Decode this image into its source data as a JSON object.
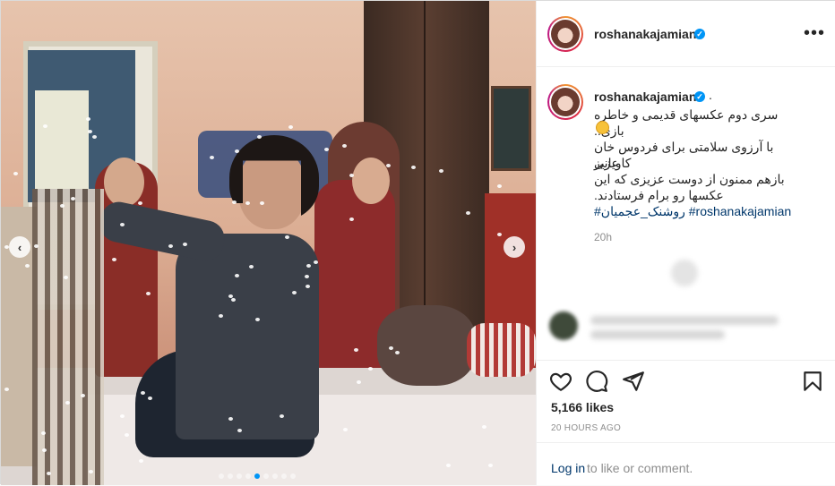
{
  "post": {
    "username": "roshanakajamian",
    "verified_mark": "✓",
    "more_label": "•••",
    "caption": {
      "username": "roshanakajamian",
      "trailing_dot": ".",
      "line1": "سری دوم عکسهای قدیمی و خاطره بازی..",
      "line2": "با آرزوی سلامتی برای فردوس خان کاویانی",
      "line3": "عزیز",
      "line4": "بازهم ممنون از دوست عزیزی که این",
      "line5": "عکسها رو برام فرستادند.",
      "hashtag1": "#روشنک_عجمیان",
      "hashtag2": "#roshanakajamian",
      "time": "20h"
    },
    "likes": "5,166 likes",
    "posted_ago": "20 HOURS AGO",
    "login_link": "Log in",
    "login_rest": "to like or comment."
  },
  "media": {
    "prev_arrow": "‹",
    "next_arrow": "›",
    "slide_count": 9,
    "active_slide": 4
  },
  "colors": {
    "accent_blue": "#0095f6",
    "link": "#00376b",
    "muted": "#8e8e8e"
  },
  "icons": [
    "heart-icon",
    "comment-icon",
    "share-icon",
    "bookmark-icon",
    "more-icon",
    "verified-icon",
    "emoji-icon"
  ]
}
